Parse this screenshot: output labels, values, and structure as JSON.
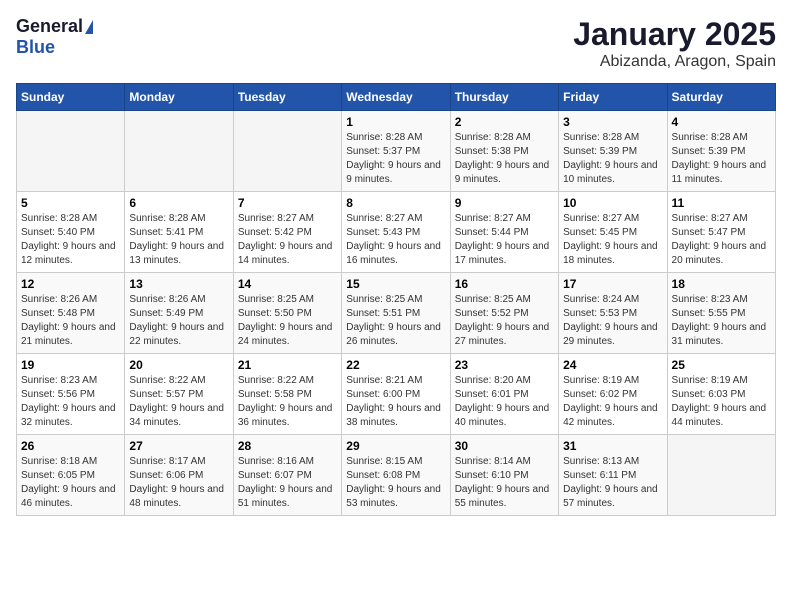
{
  "logo": {
    "general": "General",
    "blue": "Blue"
  },
  "title": "January 2025",
  "subtitle": "Abizanda, Aragon, Spain",
  "days_of_week": [
    "Sunday",
    "Monday",
    "Tuesday",
    "Wednesday",
    "Thursday",
    "Friday",
    "Saturday"
  ],
  "weeks": [
    [
      {
        "day": null
      },
      {
        "day": null
      },
      {
        "day": null
      },
      {
        "day": "1",
        "sunrise": "8:28 AM",
        "sunset": "5:37 PM",
        "daylight": "9 hours and 9 minutes."
      },
      {
        "day": "2",
        "sunrise": "8:28 AM",
        "sunset": "5:38 PM",
        "daylight": "9 hours and 9 minutes."
      },
      {
        "day": "3",
        "sunrise": "8:28 AM",
        "sunset": "5:39 PM",
        "daylight": "9 hours and 10 minutes."
      },
      {
        "day": "4",
        "sunrise": "8:28 AM",
        "sunset": "5:39 PM",
        "daylight": "9 hours and 11 minutes."
      }
    ],
    [
      {
        "day": "5",
        "sunrise": "8:28 AM",
        "sunset": "5:40 PM",
        "daylight": "9 hours and 12 minutes."
      },
      {
        "day": "6",
        "sunrise": "8:28 AM",
        "sunset": "5:41 PM",
        "daylight": "9 hours and 13 minutes."
      },
      {
        "day": "7",
        "sunrise": "8:27 AM",
        "sunset": "5:42 PM",
        "daylight": "9 hours and 14 minutes."
      },
      {
        "day": "8",
        "sunrise": "8:27 AM",
        "sunset": "5:43 PM",
        "daylight": "9 hours and 16 minutes."
      },
      {
        "day": "9",
        "sunrise": "8:27 AM",
        "sunset": "5:44 PM",
        "daylight": "9 hours and 17 minutes."
      },
      {
        "day": "10",
        "sunrise": "8:27 AM",
        "sunset": "5:45 PM",
        "daylight": "9 hours and 18 minutes."
      },
      {
        "day": "11",
        "sunrise": "8:27 AM",
        "sunset": "5:47 PM",
        "daylight": "9 hours and 20 minutes."
      }
    ],
    [
      {
        "day": "12",
        "sunrise": "8:26 AM",
        "sunset": "5:48 PM",
        "daylight": "9 hours and 21 minutes."
      },
      {
        "day": "13",
        "sunrise": "8:26 AM",
        "sunset": "5:49 PM",
        "daylight": "9 hours and 22 minutes."
      },
      {
        "day": "14",
        "sunrise": "8:25 AM",
        "sunset": "5:50 PM",
        "daylight": "9 hours and 24 minutes."
      },
      {
        "day": "15",
        "sunrise": "8:25 AM",
        "sunset": "5:51 PM",
        "daylight": "9 hours and 26 minutes."
      },
      {
        "day": "16",
        "sunrise": "8:25 AM",
        "sunset": "5:52 PM",
        "daylight": "9 hours and 27 minutes."
      },
      {
        "day": "17",
        "sunrise": "8:24 AM",
        "sunset": "5:53 PM",
        "daylight": "9 hours and 29 minutes."
      },
      {
        "day": "18",
        "sunrise": "8:23 AM",
        "sunset": "5:55 PM",
        "daylight": "9 hours and 31 minutes."
      }
    ],
    [
      {
        "day": "19",
        "sunrise": "8:23 AM",
        "sunset": "5:56 PM",
        "daylight": "9 hours and 32 minutes."
      },
      {
        "day": "20",
        "sunrise": "8:22 AM",
        "sunset": "5:57 PM",
        "daylight": "9 hours and 34 minutes."
      },
      {
        "day": "21",
        "sunrise": "8:22 AM",
        "sunset": "5:58 PM",
        "daylight": "9 hours and 36 minutes."
      },
      {
        "day": "22",
        "sunrise": "8:21 AM",
        "sunset": "6:00 PM",
        "daylight": "9 hours and 38 minutes."
      },
      {
        "day": "23",
        "sunrise": "8:20 AM",
        "sunset": "6:01 PM",
        "daylight": "9 hours and 40 minutes."
      },
      {
        "day": "24",
        "sunrise": "8:19 AM",
        "sunset": "6:02 PM",
        "daylight": "9 hours and 42 minutes."
      },
      {
        "day": "25",
        "sunrise": "8:19 AM",
        "sunset": "6:03 PM",
        "daylight": "9 hours and 44 minutes."
      }
    ],
    [
      {
        "day": "26",
        "sunrise": "8:18 AM",
        "sunset": "6:05 PM",
        "daylight": "9 hours and 46 minutes."
      },
      {
        "day": "27",
        "sunrise": "8:17 AM",
        "sunset": "6:06 PM",
        "daylight": "9 hours and 48 minutes."
      },
      {
        "day": "28",
        "sunrise": "8:16 AM",
        "sunset": "6:07 PM",
        "daylight": "9 hours and 51 minutes."
      },
      {
        "day": "29",
        "sunrise": "8:15 AM",
        "sunset": "6:08 PM",
        "daylight": "9 hours and 53 minutes."
      },
      {
        "day": "30",
        "sunrise": "8:14 AM",
        "sunset": "6:10 PM",
        "daylight": "9 hours and 55 minutes."
      },
      {
        "day": "31",
        "sunrise": "8:13 AM",
        "sunset": "6:11 PM",
        "daylight": "9 hours and 57 minutes."
      },
      {
        "day": null
      }
    ]
  ]
}
